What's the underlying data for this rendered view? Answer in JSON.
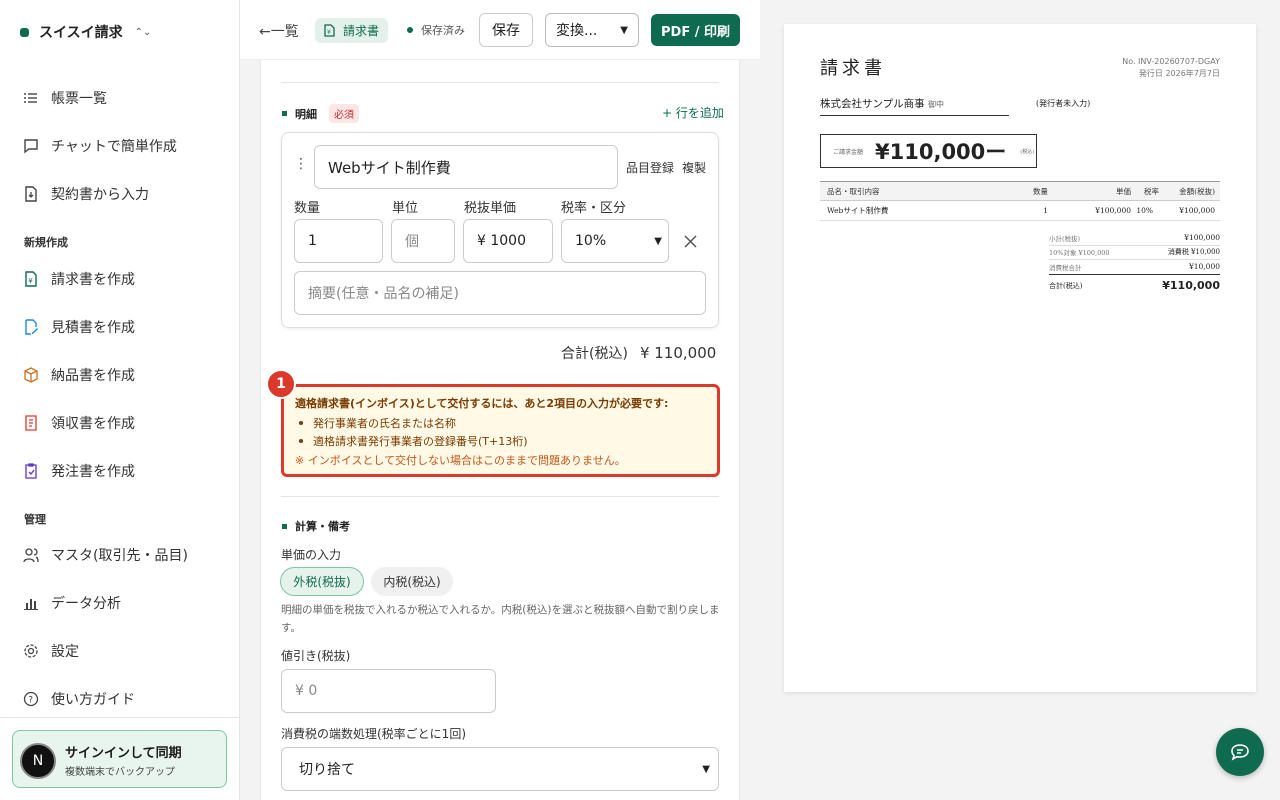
{
  "app": {
    "name": "スイスイ請求"
  },
  "nav": {
    "items": [
      {
        "label": "帳票一覧"
      },
      {
        "label": "チャットで簡単作成"
      },
      {
        "label": "契約書から入力"
      }
    ],
    "new_section": "新規作成",
    "new_items": [
      {
        "label": "請求書を作成"
      },
      {
        "label": "見積書を作成"
      },
      {
        "label": "納品書を作成"
      },
      {
        "label": "領収書を作成"
      },
      {
        "label": "発注書を作成"
      }
    ],
    "admin_section": "管理",
    "admin_items": [
      {
        "label": "マスタ(取引先・品目)"
      },
      {
        "label": "データ分析"
      },
      {
        "label": "設定"
      },
      {
        "label": "使い方ガイド"
      }
    ]
  },
  "signin": {
    "avatar": "N",
    "title": "サインインして同期",
    "subtitle": "複数端末でバックアップ"
  },
  "toolbar": {
    "back": "←一覧",
    "doc_type": "請求書",
    "status": "保存済み",
    "save": "保存",
    "convert": "変換...",
    "pdf": "PDF / 印刷"
  },
  "lines": {
    "title": "明細",
    "required": "必須",
    "add_row": "+ 行を追加",
    "item": {
      "name": "Webサイト制作費",
      "register": "品目登録",
      "duplicate": "複製",
      "qty_label": "数量",
      "unit_label": "単位",
      "price_label": "税抜単価",
      "tax_label": "税率・区分",
      "qty": "1",
      "unit_placeholder": "個",
      "price": "¥ 1000",
      "tax": "10%",
      "memo_placeholder": "摘要(任意・品名の補足)"
    },
    "total_label": "合計(税込)",
    "total_value": "¥ 110,000"
  },
  "warning": {
    "badge": "1",
    "title": "適格請求書(インボイス)として交付するには、あと2項目の入力が必要です:",
    "items": [
      "発行事業者の氏名または名称",
      "適格請求書発行事業者の登録番号(T+13桁)"
    ],
    "note": "※ インボイスとして交付しない場合はこのままで問題ありません。"
  },
  "calc": {
    "title": "計算・備考",
    "price_input_label": "単価の入力",
    "opt_exclusive": "外税(税抜)",
    "opt_inclusive": "内税(税込)",
    "help": "明細の単価を税抜で入れるか税込で入れるか。内税(税込)を選ぶと税抜額へ自動で割り戻します。",
    "discount_label": "値引き(税抜)",
    "discount_placeholder": "¥ 0",
    "rounding_label": "消費税の端数処理(税率ごとに1回)",
    "rounding_value": "切り捨て"
  },
  "preview": {
    "title": "請求書",
    "number": "No. INV-20260707-DGAY",
    "date": "発行日 2026年7月7日",
    "client": "株式会社サンプル商事",
    "honorific": "御中",
    "issuer": "(発行者未入力)",
    "amount_label": "ご請求金額",
    "amount": "¥110,000ー",
    "amount_note": "(税込)",
    "table_headers": [
      "品名・取引内容",
      "数量",
      "単価",
      "税率",
      "金額(税抜)"
    ],
    "rows": [
      [
        "Webサイト制作費",
        "1",
        "¥100,000",
        "10%",
        "¥100,000"
      ]
    ],
    "subtotal_label": "小計(税抜)",
    "subtotal": "¥100,000",
    "taxbase_label": "10%対象 ¥100,000",
    "tax_label": "消費税 ¥10,000",
    "taxtotal_label": "消費税合計",
    "taxtotal": "¥10,000",
    "grand_label": "合計(税込)",
    "grand": "¥110,000"
  }
}
